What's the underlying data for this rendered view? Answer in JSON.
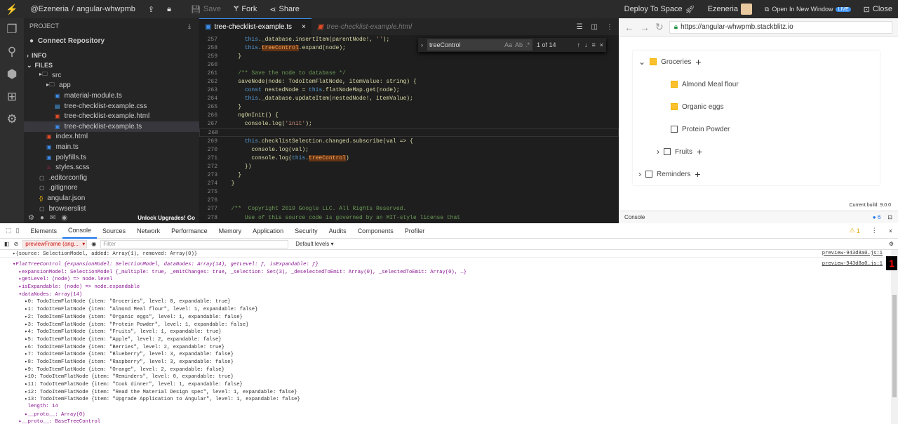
{
  "topbar": {
    "user_left": "@Ezeneria",
    "sep": "/",
    "project": "angular-whwpmb",
    "save": "Save",
    "fork": "Fork",
    "share": "Share",
    "deploy": "Deploy To Space",
    "user": "Ezeneria",
    "open_new": "Open In New Window",
    "live": "LIVE",
    "close": "Close"
  },
  "sidebar": {
    "project_label": "PROJECT",
    "connect": "Connect Repository",
    "info": "INFO",
    "files": "FILES",
    "tree": [
      {
        "label": "src",
        "icon": "folder"
      },
      {
        "label": "app",
        "icon": "folder"
      },
      {
        "label": "material-module.ts",
        "icon": "ts"
      },
      {
        "label": "tree-checklist-example.css",
        "icon": "css"
      },
      {
        "label": "tree-checklist-example.html",
        "icon": "html"
      },
      {
        "label": "tree-checklist-example.ts",
        "icon": "ts"
      },
      {
        "label": "index.html",
        "icon": "html"
      },
      {
        "label": "main.ts",
        "icon": "ts"
      },
      {
        "label": "polyfills.ts",
        "icon": "ts"
      },
      {
        "label": "styles.scss",
        "icon": "scss"
      },
      {
        "label": ".editorconfig",
        "icon": "file"
      },
      {
        "label": ".gitignore",
        "icon": "file"
      },
      {
        "label": "angular.json",
        "icon": "json"
      },
      {
        "label": "browserslist",
        "icon": "file"
      }
    ],
    "unlock": "Unlock Upgrades! Go"
  },
  "editor": {
    "tab_active": "tree-checklist-example.ts",
    "tab_inactive": "tree-checklist-example.html",
    "find": {
      "query": "treeControl",
      "opt_case": "Aa",
      "opt_word": "Ab",
      "opt_regex": ".*",
      "count": "1 of 14"
    },
    "lines": [
      {
        "n": "257",
        "code": "      this._database.insertItem(parentNode!, '');"
      },
      {
        "n": "258",
        "code": "      this.treeControl.expand(node);"
      },
      {
        "n": "259",
        "code": "    }"
      },
      {
        "n": "260",
        "code": ""
      },
      {
        "n": "261",
        "code": "    /** Save the node to database */"
      },
      {
        "n": "262",
        "code": "    saveNode(node: TodoItemFlatNode, itemValue: string) {"
      },
      {
        "n": "263",
        "code": "      const nestedNode = this.flatNodeMap.get(node);"
      },
      {
        "n": "264",
        "code": "      this._database.updateItem(nestedNode!, itemValue);"
      },
      {
        "n": "265",
        "code": "    }"
      },
      {
        "n": "266",
        "code": "    ngOnInit() {"
      },
      {
        "n": "267",
        "code": "      console.log('init');"
      },
      {
        "n": "268",
        "code": "      "
      },
      {
        "n": "269",
        "code": "      this.checklistSelection.changed.subscribe(val => {"
      },
      {
        "n": "270",
        "code": "        console.log(val);"
      },
      {
        "n": "271",
        "code": "        console.log(this.treeControl)"
      },
      {
        "n": "272",
        "code": "      })"
      },
      {
        "n": "273",
        "code": "    }"
      },
      {
        "n": "274",
        "code": "  }"
      },
      {
        "n": "275",
        "code": ""
      },
      {
        "n": "276",
        "code": ""
      },
      {
        "n": "277",
        "code": "  /**  Copyright 2019 Google LLC. All Rights Reserved."
      },
      {
        "n": "278",
        "code": "      Use of this source code is governed by an MIT-style license that"
      }
    ]
  },
  "preview": {
    "url": "https://angular-whwpmb.stackblitz.io",
    "build": "Current build: 9.0.0",
    "tree": [
      {
        "label": "Groceries",
        "checked": true,
        "chevron": "down",
        "plus": true
      },
      {
        "label": "Almond Meal flour",
        "checked": true
      },
      {
        "label": "Organic eggs",
        "checked": true
      },
      {
        "label": "Protein Powder",
        "checked": false
      },
      {
        "label": "Fruits",
        "checked": false,
        "chevron": "right",
        "plus": true
      },
      {
        "label": "Reminders",
        "checked": false,
        "chevron": "right",
        "plus": true
      }
    ],
    "console_label": "Console"
  },
  "devtools": {
    "tabs": [
      "Elements",
      "Console",
      "Sources",
      "Network",
      "Performance",
      "Memory",
      "Application",
      "Security",
      "Audits",
      "Components",
      "Profiler"
    ],
    "active_tab": "Console",
    "warn_count": "1",
    "context": "previewFrame (ang...",
    "filter_placeholder": "Filter",
    "levels": "Default levels",
    "rows": [
      {
        "t": "▸{source: SelectionModel, added: Array(1), removed: Array(0)}",
        "src": "preview-943d8a0…js:1"
      },
      {
        "t": "▾FlatTreeControl {expansionModel: SelectionModel, dataNodes: Array(14), getLevel: ƒ, isExpandable: ƒ}",
        "src": "preview-943d8a0…js:1"
      },
      {
        "t": "  ▸expansionModel: SelectionModel {_multiple: true, _emitChanges: true, _selection: Set(3), _deselectedToEmit: Array(0), _selectedToEmit: Array(0), …}"
      },
      {
        "t": "  ▸getLevel: (node) => node.level"
      },
      {
        "t": "  ▸isExpandable: (node) => node.expandable"
      },
      {
        "t": "  ▾dataNodes: Array(14)"
      },
      {
        "t": "    ▸0: TodoItemFlatNode {item: \"Groceries\", level: 0, expandable: true}"
      },
      {
        "t": "    ▸1: TodoItemFlatNode {item: \"Almond Meal flour\", level: 1, expandable: false}"
      },
      {
        "t": "    ▸2: TodoItemFlatNode {item: \"Organic eggs\", level: 1, expandable: false}"
      },
      {
        "t": "    ▸3: TodoItemFlatNode {item: \"Protein Powder\", level: 1, expandable: false}"
      },
      {
        "t": "    ▸4: TodoItemFlatNode {item: \"Fruits\", level: 1, expandable: true}"
      },
      {
        "t": "    ▸5: TodoItemFlatNode {item: \"Apple\", level: 2, expandable: false}"
      },
      {
        "t": "    ▸6: TodoItemFlatNode {item: \"Berries\", level: 2, expandable: true}"
      },
      {
        "t": "    ▸7: TodoItemFlatNode {item: \"Blueberry\", level: 3, expandable: false}"
      },
      {
        "t": "    ▸8: TodoItemFlatNode {item: \"Raspberry\", level: 3, expandable: false}"
      },
      {
        "t": "    ▸9: TodoItemFlatNode {item: \"Orange\", level: 2, expandable: false}"
      },
      {
        "t": "    ▸10: TodoItemFlatNode {item: \"Reminders\", level: 0, expandable: true}"
      },
      {
        "t": "    ▸11: TodoItemFlatNode {item: \"Cook dinner\", level: 1, expandable: false}"
      },
      {
        "t": "    ▸12: TodoItemFlatNode {item: \"Read the Material Design spec\", level: 1, expandable: false}"
      },
      {
        "t": "    ▸13: TodoItemFlatNode {item: \"Upgrade Application to Angular\", level: 1, expandable: false}"
      },
      {
        "t": "     length: 14"
      },
      {
        "t": "    ▸__proto__: Array(0)"
      },
      {
        "t": "  ▸__proto__: BaseTreeControl"
      }
    ]
  },
  "colors": {
    "accent": "#3b8eea",
    "checkbox": "#fbc02d",
    "find_highlight": "#613315"
  }
}
